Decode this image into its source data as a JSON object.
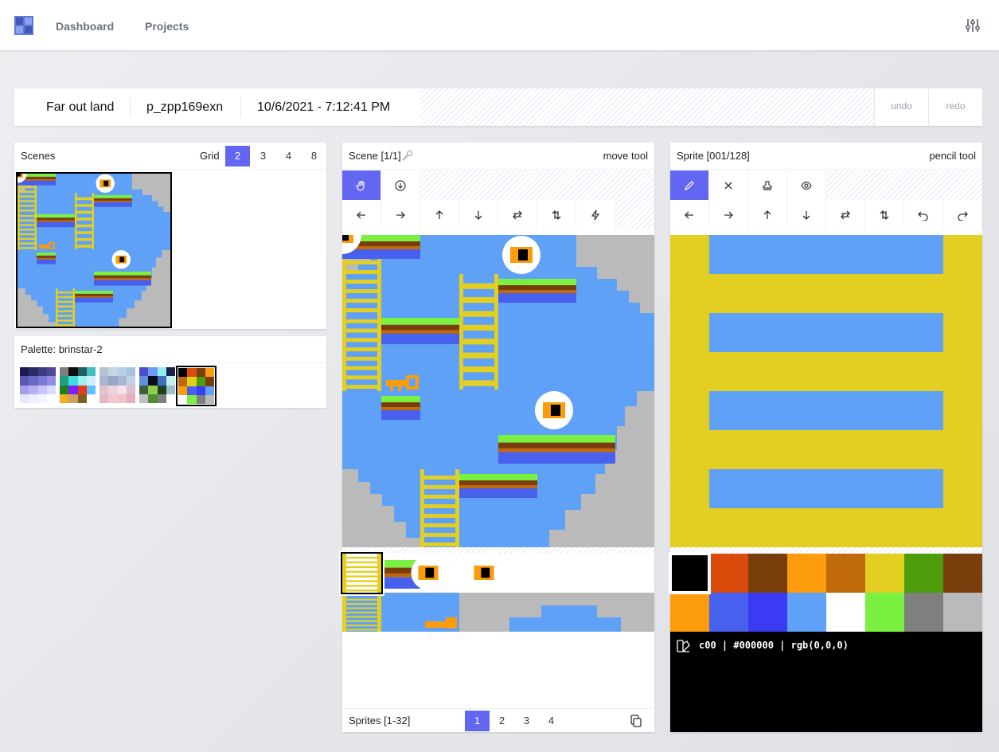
{
  "nav": {
    "links": [
      "Dashboard",
      "Projects"
    ]
  },
  "project": {
    "name": "Far out land",
    "id": "p_zpp169exn",
    "date": "10/6/2021 - 7:12:41 PM",
    "undo": "undo",
    "redo": "redo"
  },
  "scenes": {
    "title": "Scenes",
    "grid_label": "Grid",
    "grid_options": [
      "2",
      "3",
      "4",
      "8"
    ],
    "selected_grid": "2"
  },
  "palette": {
    "title": "Palette: brinstar-2"
  },
  "scene": {
    "title": "Scene [1/1]",
    "tool": "move tool"
  },
  "sprites": {
    "title": "Sprites [1-32]",
    "pages": [
      "1",
      "2",
      "3",
      "4"
    ],
    "selected_page": "1"
  },
  "sprite": {
    "title": "Sprite [001/128]",
    "tool": "pencil tool"
  },
  "color_info": "c00 | #000000 | rgb(0,0,0)",
  "colors": [
    "#000000",
    "#db4b0c",
    "#7a3d0c",
    "#fc9c0c",
    "#c06a0c",
    "#e3cf22",
    "#4c9c0c",
    "#7a3d0c",
    "#fc9c0c",
    "#4760ed",
    "#3b3bf4",
    "#5ea1f7",
    "#ffffff",
    "#7af041",
    "#7f7f7f",
    "#bababa"
  ],
  "selected_color": "#000000",
  "palettes": [
    [
      "#1c1a4f",
      "#2b2a66",
      "#3d3b7c",
      "#4b4996",
      "#5a58b2",
      "#6b69c5",
      "#7c7ad6",
      "#8e8ce4",
      "#a19ff0",
      "#b4b2f5",
      "#c8c6f9",
      "#dcdbfc",
      "#e8e7ff",
      "#efeeff",
      "#f5f5ff",
      "#ffffff"
    ],
    [
      "#7f7f7f",
      "#0d0d0d",
      "#1f5f5f",
      "#3fbfbf",
      "#1f9f7f",
      "#3fdfdf",
      "#9fefef",
      "#cfefff",
      "#1f7f1f",
      "#7f1fff",
      "#df3f1f",
      "#5fbfff",
      "#efaf1f",
      "#cf9f5f",
      "#7f5f1f",
      "#ffffff"
    ],
    [
      "#b7c3d3",
      "#c7d3e3",
      "#b7cfe3",
      "#a7c3df",
      "#a7b7d3",
      "#97a7c7",
      "#a7b7cf",
      "#c3cfe3",
      "#e3c3cf",
      "#efd3db",
      "#f3e3eb",
      "#dfbfcb",
      "#e7b7c3",
      "#f3c7cf",
      "#efc3cb",
      "#e7afbb"
    ],
    [
      "#4b4bd3",
      "#6b9bef",
      "#8fefef",
      "#1f1f4f",
      "#5f8fdf",
      "#0b0b1b",
      "#3f6fbf",
      "#bfefef",
      "#3f5f3f",
      "#8fcf4f",
      "#1f3f1f",
      "#9fbfcf",
      "#bfbfbf",
      "#4f8f2f",
      "#7f7f7f",
      "#ffffff"
    ],
    [
      "#000000",
      "#db4b0c",
      "#7a3d0c",
      "#fc9c0c",
      "#c06a0c",
      "#e3cf22",
      "#4c9c0c",
      "#7a3d0c",
      "#fc9c0c",
      "#4760ed",
      "#3b3bf4",
      "#5ea1f7",
      "#ffffff",
      "#7af041",
      "#7f7f7f",
      "#bababa"
    ]
  ]
}
